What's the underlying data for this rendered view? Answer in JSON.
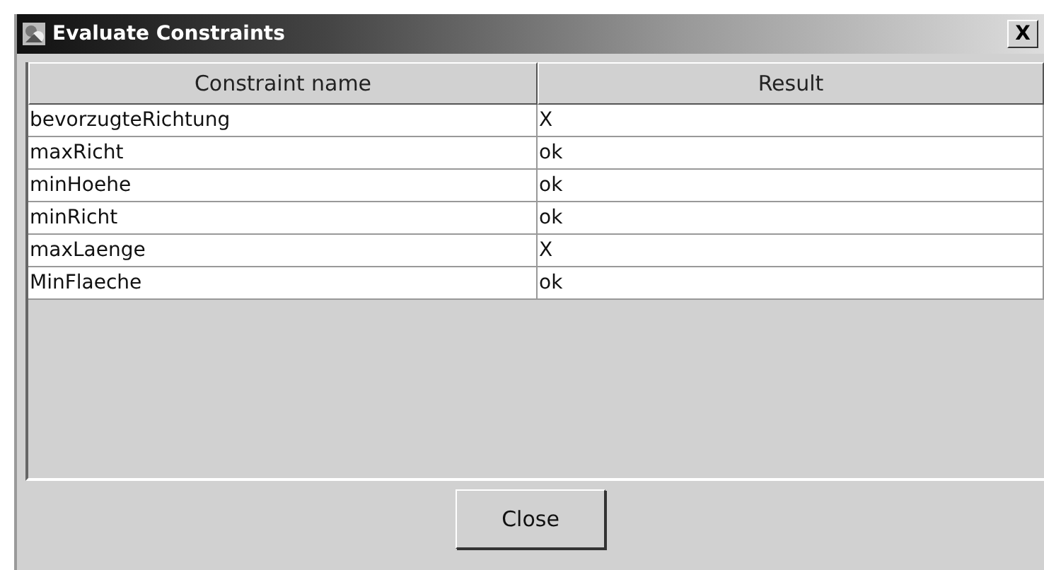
{
  "window": {
    "title": "Evaluate Constraints",
    "close_glyph": "X"
  },
  "table": {
    "columns": [
      "Constraint name",
      "Result"
    ],
    "rows": [
      {
        "cells": [
          "bevorzugteRichtung",
          "X"
        ]
      },
      {
        "cells": [
          "maxRicht",
          "ok"
        ]
      },
      {
        "cells": [
          "minHoehe",
          "ok"
        ]
      },
      {
        "cells": [
          "minRicht",
          "ok"
        ]
      },
      {
        "cells": [
          "maxLaenge",
          "X"
        ]
      },
      {
        "cells": [
          "MinFlaeche",
          "ok"
        ]
      }
    ]
  },
  "buttons": [
    "Close"
  ]
}
